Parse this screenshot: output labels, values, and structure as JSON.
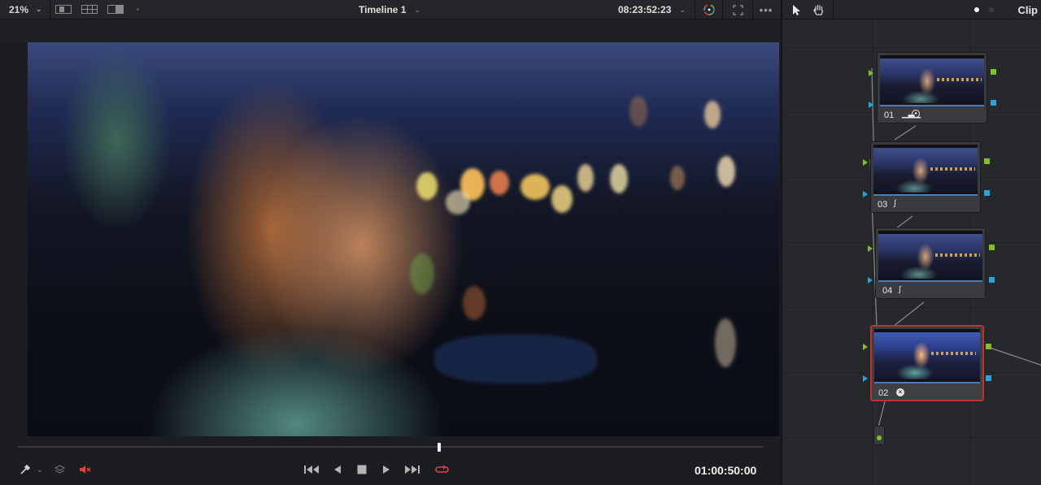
{
  "viewer": {
    "zoom": "21%",
    "timeline_name": "Timeline 1",
    "source_timecode": "08:23:52:23",
    "record_timecode": "01:00:50:00",
    "playhead_fraction": 0.566
  },
  "icons": {
    "zoom_dropdown": "chevron-down-icon",
    "single_view": "single-viewer-icon",
    "gallery_view": "split-grid-icon",
    "wipe_view": "wipe-icon",
    "color_wheel": "color-wheel-icon",
    "fullscreen": "fullscreen-icon",
    "more": "more-options-icon",
    "pointer": "pointer-icon",
    "hand": "hand-icon",
    "picker": "eyedropper-icon",
    "layers": "layers-icon",
    "mute": "mute-icon",
    "prev_clip": "skip-back-icon",
    "reverse": "play-reverse-icon",
    "stop": "stop-icon",
    "play": "play-icon",
    "next_clip": "skip-forward-icon",
    "loop": "loop-icon"
  },
  "node_panel": {
    "mode_label": "Clip",
    "nodes": [
      {
        "label": "01",
        "tools": "curves-wheels",
        "selected": false
      },
      {
        "label": "03",
        "tools": "custom-curve",
        "selected": false
      },
      {
        "label": "04",
        "tools": "custom-curve",
        "selected": false
      },
      {
        "label": "02",
        "tools": "lut",
        "selected": true
      }
    ]
  },
  "colors": {
    "accent_red": "#c4312d",
    "port_green": "#7dc02a",
    "port_blue": "#2ba4dc",
    "mute_red": "#e0433b",
    "loop_red": "#e0433b"
  }
}
